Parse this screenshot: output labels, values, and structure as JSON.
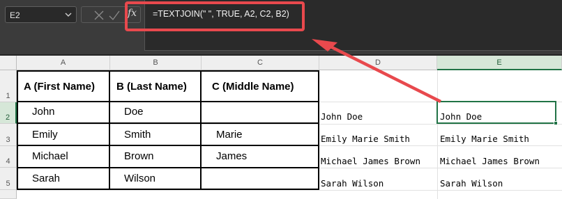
{
  "formula_bar": {
    "name_box": "E2",
    "cancel_icon": "close-icon",
    "enter_icon": "check-icon",
    "function_label": "fx",
    "formula": "=TEXTJOIN(\" \", TRUE, A2, C2, B2)"
  },
  "columns": [
    "A",
    "B",
    "C",
    "D",
    "E"
  ],
  "rows": [
    "1",
    "2",
    "3",
    "4",
    "5"
  ],
  "selection": {
    "active_cell": "E2",
    "column": "E",
    "row": "2"
  },
  "table": {
    "headers": [
      "A (First Name)",
      "B (Last Name)",
      "C (Middle Name)"
    ],
    "rows": [
      [
        "John",
        "Doe",
        ""
      ],
      [
        "Emily",
        "Smith",
        "Marie"
      ],
      [
        "Michael",
        "Brown",
        "James"
      ],
      [
        "Sarah",
        "Wilson",
        ""
      ]
    ]
  },
  "column_d": [
    "John Doe",
    "Emily Marie Smith",
    "Michael James Brown",
    "Sarah Wilson"
  ],
  "column_e": [
    "John Doe",
    "Emily Marie Smith",
    "Michael James Brown",
    "Sarah Wilson"
  ],
  "annotation": {
    "color": "#e8494d"
  },
  "colors": {
    "accent": "#217346"
  }
}
